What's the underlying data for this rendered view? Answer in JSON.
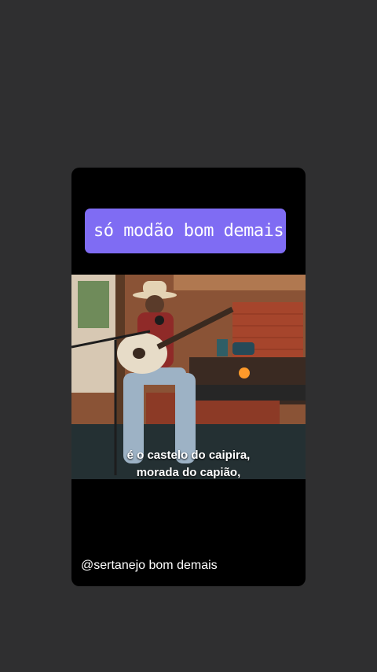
{
  "post": {
    "title": "só modão bom demais",
    "caption_line1": "é o castelo do caipira,",
    "caption_line2": "morada do capião,",
    "handle": "@sertanejo bom demais"
  },
  "colors": {
    "page_background": "#2f2f30",
    "card_background": "#000000",
    "title_box": "#7f6cf3"
  },
  "icons": [
    "guitarist-video-frame"
  ]
}
